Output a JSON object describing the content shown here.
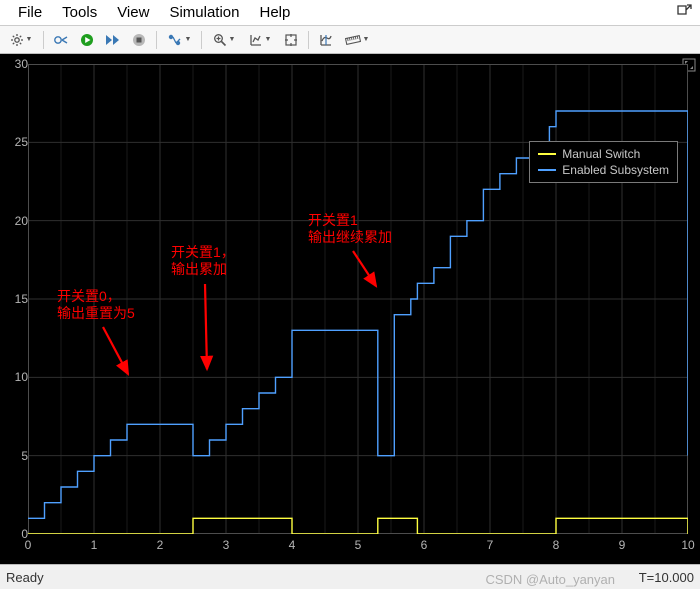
{
  "menus": [
    "File",
    "Tools",
    "View",
    "Simulation",
    "Help"
  ],
  "status": {
    "ready": "Ready",
    "time": "T=10.000"
  },
  "watermark": "CSDN @Auto_yanyan",
  "legend": {
    "series1": "Manual Switch",
    "series2": "Enabled Subsystem"
  },
  "annotations": {
    "a1_l1": "开关置0，",
    "a1_l2": "输出重置为5",
    "a2_l1": "开关置1，",
    "a2_l2": "输出累加",
    "a3_l1": "开关置1",
    "a3_l2": "输出继续累加"
  },
  "chart_data": {
    "type": "line",
    "xlabel": "",
    "ylabel": "",
    "xlim": [
      0,
      10
    ],
    "ylim": [
      0,
      30
    ],
    "xticks": [
      0,
      1,
      2,
      3,
      4,
      5,
      6,
      7,
      8,
      9,
      10
    ],
    "yticks": [
      0,
      5,
      10,
      15,
      20,
      25,
      30
    ],
    "legend_position": "upper right",
    "series": [
      {
        "name": "Manual Switch",
        "color": "#ffff40",
        "step": true,
        "x": [
          0,
          1.5,
          2.5,
          4.0,
          5.3,
          5.9,
          8.0,
          10.0
        ],
        "y": [
          0,
          0,
          1,
          0,
          1,
          0,
          1,
          0
        ],
        "comment": "switch high at [2.5,4.0), [5.3,5.9), [8.0,10.0); low elsewhere (step-after)"
      },
      {
        "name": "Enabled Subsystem",
        "color": "#4fa0ff",
        "step": true,
        "comment": "step-held output; jumps to 5 on rising switch edge then accumulates +1 each 0.25 while enabled",
        "x": [
          0,
          0.25,
          0.5,
          0.75,
          1.0,
          1.25,
          1.5,
          2.5,
          2.75,
          3.0,
          3.25,
          3.5,
          3.75,
          4.0,
          5.3,
          5.55,
          5.8,
          5.9,
          6.15,
          6.4,
          6.65,
          6.9,
          7.15,
          7.4,
          7.65,
          7.9,
          8.0,
          10.0
        ],
        "y": [
          1,
          2,
          3,
          4,
          5,
          6,
          7,
          5,
          6,
          7,
          8,
          9,
          10,
          13,
          5,
          14,
          15,
          16,
          17,
          19,
          20,
          22,
          23,
          24,
          25,
          26,
          27,
          5
        ]
      }
    ],
    "annotations": [
      {
        "text": "开关置0，输出重置为5",
        "arrow_to": [
          1.5,
          7
        ]
      },
      {
        "text": "开关置1，输出累加",
        "arrow_to": [
          2.8,
          8
        ]
      },
      {
        "text": "开关置1 输出继续累加",
        "arrow_to": [
          5.3,
          14
        ]
      }
    ]
  },
  "tooltips": {
    "gear": "Configuration",
    "goto": "Highlight block",
    "run": "Run",
    "step": "Step forward",
    "stop": "Stop",
    "trigger": "Trigger",
    "zoom": "Zoom",
    "zoomxy": "Zoom axes",
    "axes": "Autoscale",
    "cursor": "Cursor measurements",
    "ruler": "Ruler"
  }
}
